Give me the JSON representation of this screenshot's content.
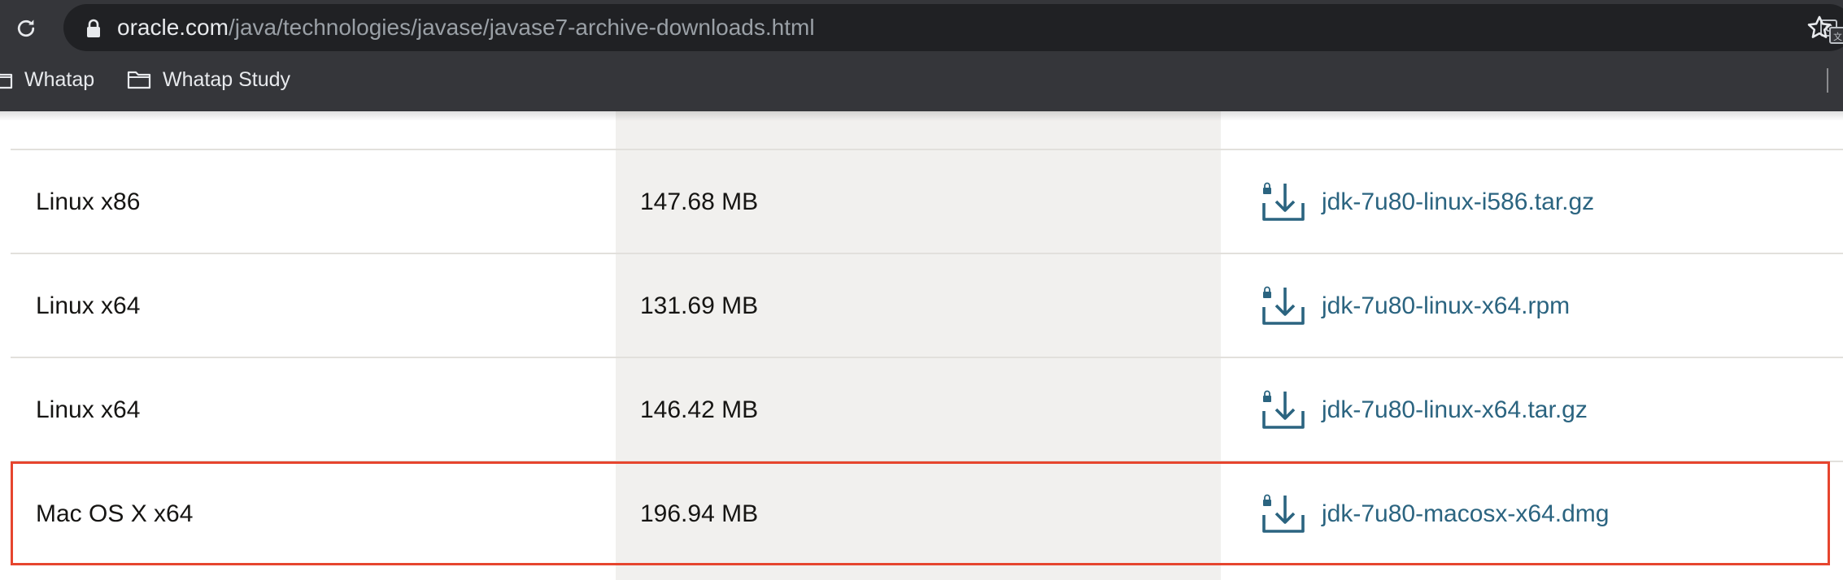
{
  "browser": {
    "url_host": "oracle.com",
    "url_path": "/java/technologies/javase/javase7-archive-downloads.html",
    "bookmarks": [
      {
        "label": "Whatap"
      },
      {
        "label": "Whatap Study"
      }
    ],
    "icons": {
      "reload": "reload-icon",
      "lock": "lock-icon",
      "translate": "translate-icon",
      "bookmark_star": "star-icon",
      "folder": "folder-icon"
    }
  },
  "downloads_table": {
    "rows": [
      {
        "os": "Linux x86",
        "size": "147.68 MB",
        "file": "jdk-7u80-linux-i586.tar.gz"
      },
      {
        "os": "Linux x64",
        "size": "131.69 MB",
        "file": "jdk-7u80-linux-x64.rpm"
      },
      {
        "os": "Linux x64",
        "size": "146.42 MB",
        "file": "jdk-7u80-linux-x64.tar.gz"
      },
      {
        "os": "Mac OS X x64",
        "size": "196.94 MB",
        "file": "jdk-7u80-macosx-x64.dmg"
      }
    ],
    "highlighted_row": 3,
    "icons": {
      "download": "download-lock-icon"
    }
  },
  "colors": {
    "chrome_bg": "#35363a",
    "omnibox_bg": "#202124",
    "link": "#2b6480",
    "highlight_border": "#e6452e",
    "mid_column_bg": "#f1f0ee"
  }
}
